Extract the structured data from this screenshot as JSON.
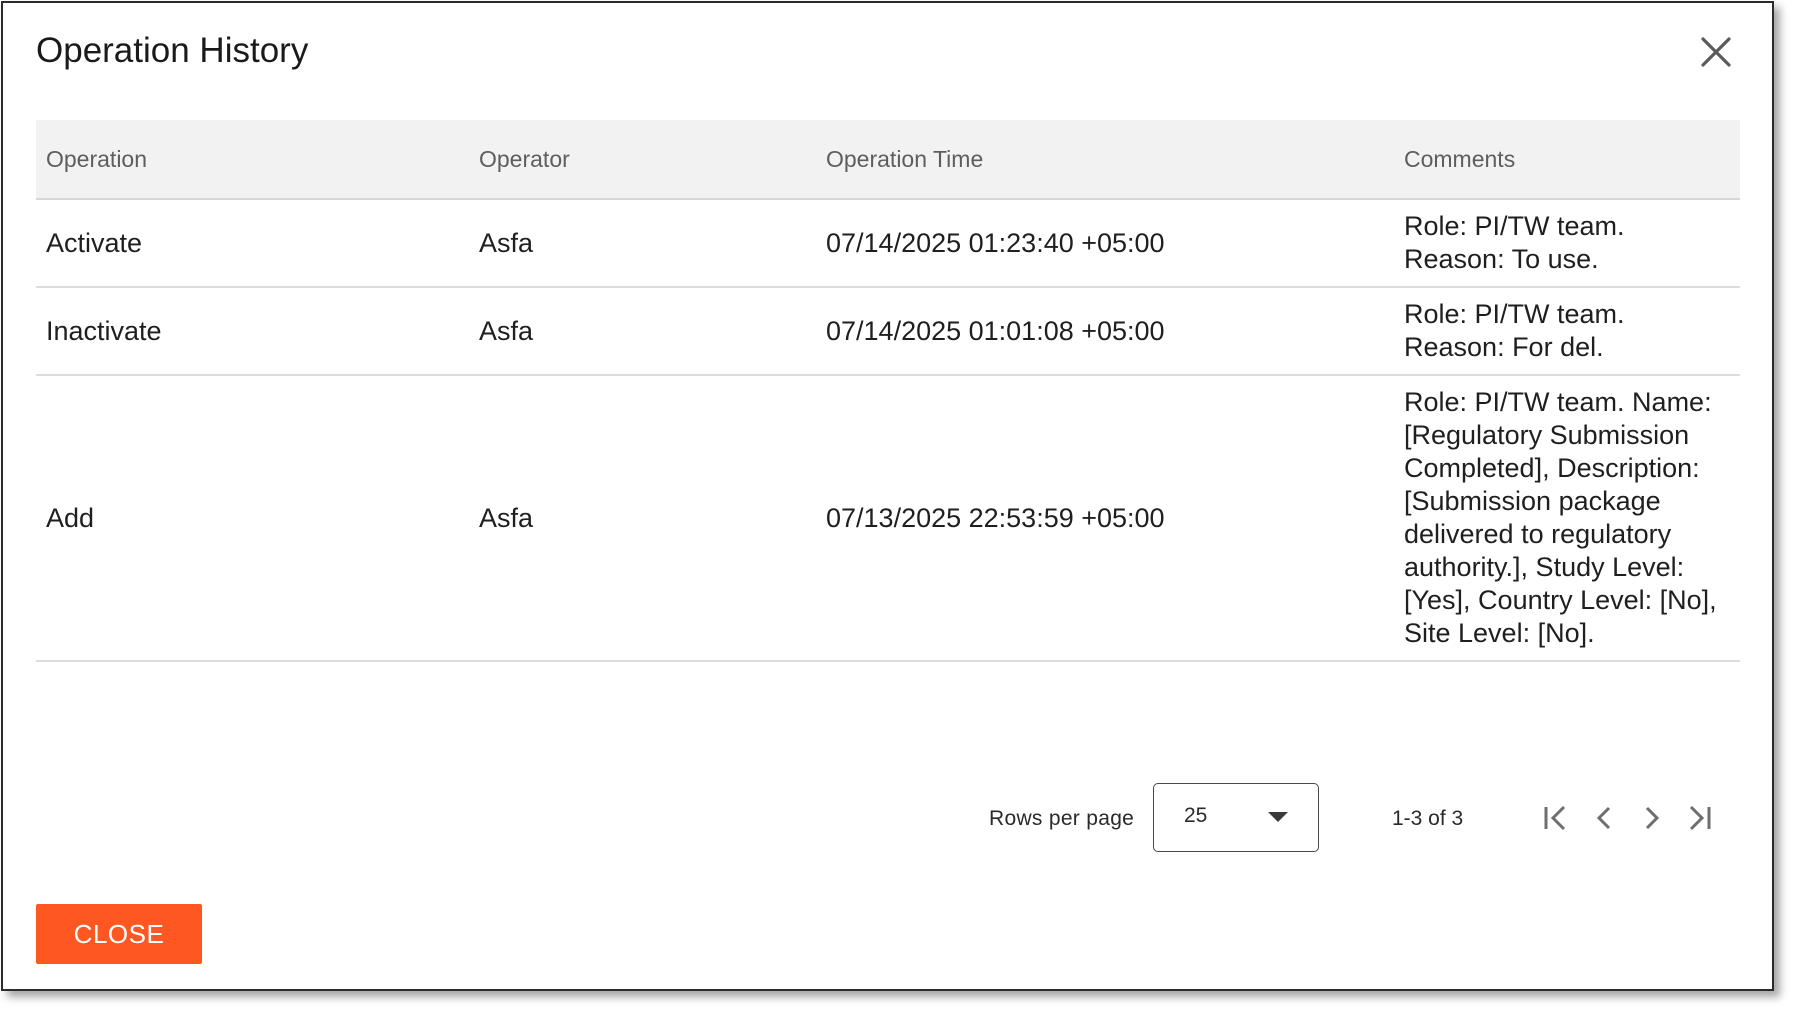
{
  "dialog": {
    "title": "Operation History",
    "close_icon": "close-icon",
    "close_button_label": "CLOSE",
    "accent_color": "#ff5722"
  },
  "table": {
    "columns": [
      "Operation",
      "Operator",
      "Operation Time",
      "Comments"
    ],
    "rows": [
      {
        "operation": "Activate",
        "operator": "Asfa",
        "time": "07/14/2025 01:23:40 +05:00",
        "comments": "Role: PI/TW team. Reason: To use."
      },
      {
        "operation": "Inactivate",
        "operator": "Asfa",
        "time": "07/14/2025 01:01:08 +05:00",
        "comments": "Role: PI/TW team. Reason: For del."
      },
      {
        "operation": "Add",
        "operator": "Asfa",
        "time": "07/13/2025 22:53:59 +05:00",
        "comments": "Role: PI/TW team. Name: [Regulatory Submission Completed], Description: [Submission package delivered to regulatory authority.], Study Level: [Yes], Country Level: [No], Site Level: [No]."
      }
    ]
  },
  "pagination": {
    "rows_per_page_label": "Rows per page",
    "rows_per_page_value": "25",
    "range_text": "1-3 of 3",
    "icons": [
      "first-page-icon",
      "chevron-left-icon",
      "chevron-right-icon",
      "last-page-icon"
    ]
  }
}
